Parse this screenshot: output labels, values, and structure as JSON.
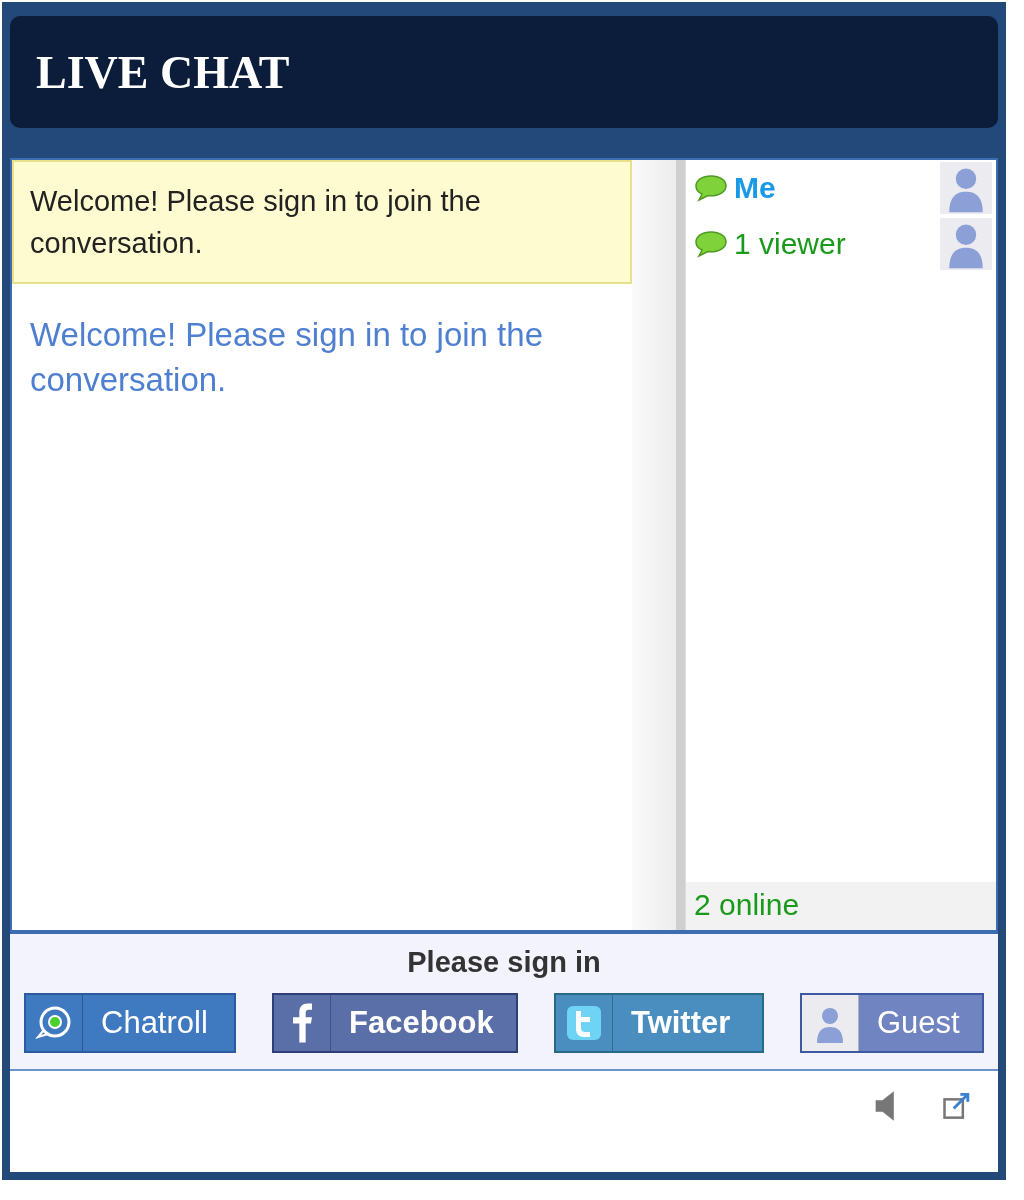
{
  "header": {
    "title": "LIVE CHAT"
  },
  "notice": "Welcome! Please sign in to join the conversation.",
  "messages": [
    {
      "text": "Welcome! Please sign in to join the conversation."
    }
  ],
  "users": [
    {
      "name": "Me",
      "kind": "self"
    },
    {
      "name": "1 viewer",
      "kind": "viewer"
    }
  ],
  "online_count": "2 online",
  "sign_in": {
    "title": "Please sign in",
    "buttons": [
      {
        "label": "Chatroll",
        "kind": "chatroll"
      },
      {
        "label": "Facebook",
        "kind": "facebook"
      },
      {
        "label": "Twitter",
        "kind": "twitter"
      },
      {
        "label": "Guest",
        "kind": "guest"
      }
    ]
  }
}
